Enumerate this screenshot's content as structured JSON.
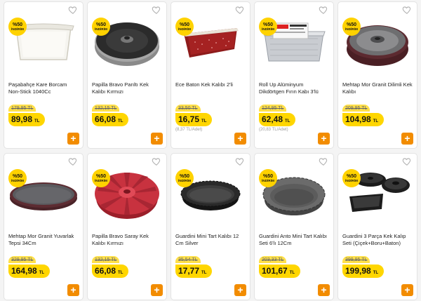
{
  "badge": {
    "percent": "%50",
    "label": "İNDİRİM"
  },
  "currency": "TL",
  "colors": {
    "accent": "#ffd600",
    "add_button": "#f28c00"
  },
  "products": [
    {
      "title": "Paşabahçe Kare Borcam Non-Stick 1040Cc",
      "old_price": "179,95 TL",
      "price": "89,98",
      "unit_price": "",
      "image": "glass-baking-dish"
    },
    {
      "title": "Papilla Bravo Parıltı Kek Kalıbı Kırmızı",
      "old_price": "132,15 TL",
      "price": "66,08",
      "unit_price": "",
      "image": "bundt-pan-granite"
    },
    {
      "title": "Ece Baton Kek Kalıbı 2'li",
      "old_price": "33,50 TL",
      "price": "16,75",
      "unit_price": "(8,37 TL/Adet)",
      "image": "loaf-pan-red"
    },
    {
      "title": "Roll Up Alüminyum Dikdörtgen Fırın Kabı 3'lü",
      "old_price": "124,95 TL",
      "price": "62,48",
      "unit_price": "(20,83 TL/Adet)",
      "image": "aluminium-tray-pack"
    },
    {
      "title": "Mehtap Mor Granit Dilimli Kek Kalıbı",
      "old_price": "209,95 TL",
      "price": "104,98",
      "unit_price": "",
      "image": "bundt-pan-purple"
    },
    {
      "title": "Mehtap Mor Granit Yuvarlak Tepsi 34Cm",
      "old_price": "329,95 TL",
      "price": "164,98",
      "unit_price": "",
      "image": "round-tray"
    },
    {
      "title": "Papilla Bravo Saray Kek Kalıbı Kırmızı",
      "old_price": "132,15 TL",
      "price": "66,08",
      "unit_price": "",
      "image": "bundt-pan-red"
    },
    {
      "title": "Guardini Mini Tart Kalıbı 12 Cm Silver",
      "old_price": "35,54 TL",
      "price": "17,77",
      "unit_price": "",
      "image": "tart-pan-black"
    },
    {
      "title": "Guardini Anto Mini Tart Kalıbı Seti 6'lı 12Cm",
      "old_price": "203,33 TL",
      "price": "101,67",
      "unit_price": "",
      "image": "tart-pan-grey"
    },
    {
      "title": "Guardini 3 Parça Kek Kalıp Seti (Çiçek+Boru+Baton)",
      "old_price": "399,95 TL",
      "price": "199,98",
      "unit_price": "",
      "image": "cake-pan-set"
    }
  ]
}
